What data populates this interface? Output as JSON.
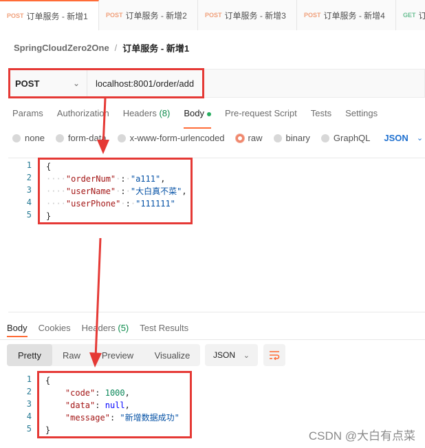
{
  "tabs": [
    {
      "method": "POST",
      "title": "订单服务 - 新增1",
      "active": true
    },
    {
      "method": "POST",
      "title": "订单服务 - 新增2",
      "active": false
    },
    {
      "method": "POST",
      "title": "订单服务 - 新增3",
      "active": false
    },
    {
      "method": "POST",
      "title": "订单服务 - 新增4",
      "active": false
    },
    {
      "method": "GET",
      "title": "订...",
      "active": false
    }
  ],
  "breadcrumb": {
    "collection": "SpringCloudZero2One",
    "separator": "/",
    "request": "订单服务 - 新增1"
  },
  "request": {
    "method": "POST",
    "url": "localhost:8001/order/add",
    "tabs": {
      "params": "Params",
      "authorization": "Authorization",
      "headers": "Headers",
      "headers_count": "(8)",
      "body": "Body",
      "prerequest": "Pre-request Script",
      "tests": "Tests",
      "settings": "Settings"
    },
    "body_types": {
      "none": "none",
      "form_data": "form-data",
      "urlencoded": "x-www-form-urlencoded",
      "raw": "raw",
      "binary": "binary",
      "graphql": "GraphQL",
      "format": "JSON"
    },
    "body_lines": [
      {
        "n": "1",
        "text": "{"
      },
      {
        "n": "2",
        "key": "\"orderNum\"",
        "value": "\"a111\"",
        "trail": ","
      },
      {
        "n": "3",
        "key": "\"userName\"",
        "value": "\"大白真不菜\"",
        "trail": ","
      },
      {
        "n": "4",
        "key": "\"userPhone\"",
        "value": "\"111111\"",
        "trail": ""
      },
      {
        "n": "5",
        "text": "}"
      }
    ]
  },
  "response": {
    "tabs": {
      "body": "Body",
      "cookies": "Cookies",
      "headers": "Headers",
      "headers_count": "(5)",
      "test_results": "Test Results"
    },
    "views": {
      "pretty": "Pretty",
      "raw": "Raw",
      "preview": "Preview",
      "visualize": "Visualize"
    },
    "format": "JSON",
    "body_lines": [
      {
        "n": "1",
        "text": "{"
      },
      {
        "n": "2",
        "key": "\"code\"",
        "value": "1000",
        "trail": ","
      },
      {
        "n": "3",
        "key": "\"data\"",
        "value": "null",
        "trail": ","
      },
      {
        "n": "4",
        "key": "\"message\"",
        "value": "\"新增数据成功\"",
        "trail": ""
      },
      {
        "n": "5",
        "text": "}"
      }
    ]
  },
  "watermark": "CSDN @大白有点菜",
  "colors": {
    "accent": "#ff6c37",
    "annotation_red": "#e53935",
    "json_key": "#a31515",
    "json_string": "#0451a5",
    "json_number": "#098658"
  }
}
